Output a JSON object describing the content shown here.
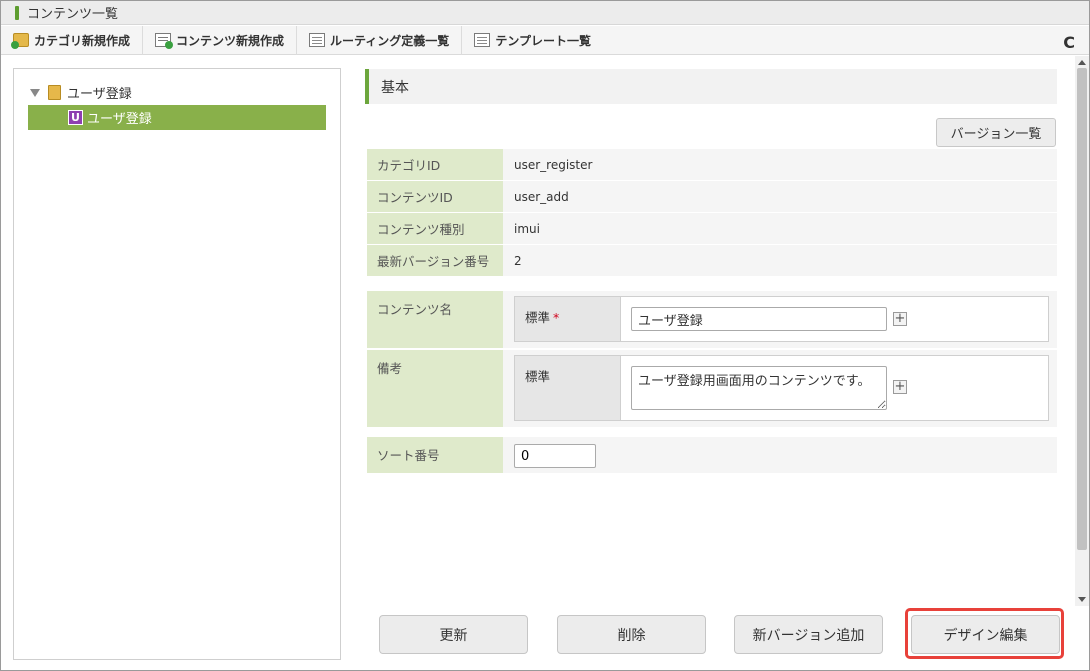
{
  "window": {
    "title": "コンテンツ一覧"
  },
  "toolbar": {
    "items": [
      {
        "label": "カテゴリ新規作成",
        "icon": "folder-add-icon"
      },
      {
        "label": "コンテンツ新規作成",
        "icon": "content-add-icon"
      },
      {
        "label": "ルーティング定義一覧",
        "icon": "list-icon"
      },
      {
        "label": "テンプレート一覧",
        "icon": "list-icon"
      }
    ],
    "refresh_icon": "C"
  },
  "tree": {
    "root_label": "ユーザ登録",
    "child_label": "ユーザ登録",
    "child_badge": "U"
  },
  "section": {
    "title": "基本"
  },
  "version_list_button": "バージョン一覧",
  "info": [
    {
      "label": "カテゴリID",
      "value": "user_register"
    },
    {
      "label": "コンテンツID",
      "value": "user_add"
    },
    {
      "label": "コンテンツ種別",
      "value": "imui"
    },
    {
      "label": "最新バージョン番号",
      "value": "2"
    }
  ],
  "form": {
    "content_name": {
      "label": "コンテンツ名",
      "locale_label": "標準",
      "required_mark": "*",
      "value": "ユーザ登録"
    },
    "remarks": {
      "label": "備考",
      "locale_label": "標準",
      "value": "ユーザ登録用画面用のコンテンツです。"
    },
    "sort": {
      "label": "ソート番号",
      "value": "0"
    },
    "plus_symbol": "+"
  },
  "buttons": {
    "update": "更新",
    "delete": "削除",
    "add_version": "新バージョン追加",
    "design_edit": "デザイン編集"
  },
  "colors": {
    "accent_green": "#89b04a",
    "label_bg": "#dfeacb",
    "highlight_red": "#e8413a"
  }
}
